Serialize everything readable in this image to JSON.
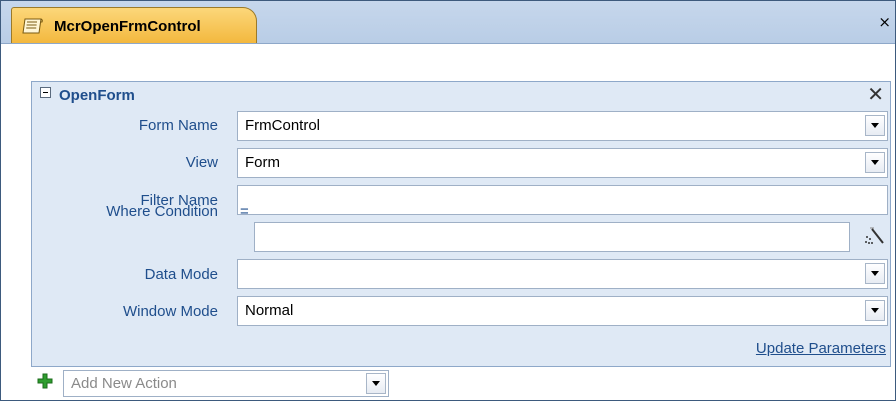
{
  "tab": {
    "title": "McrOpenFrmControl",
    "close": "×"
  },
  "action": {
    "name": "OpenForm",
    "remove": "✕",
    "rows": [
      {
        "label": "Form Name",
        "value": "FrmControl",
        "type": "dropdown"
      },
      {
        "label": "View",
        "value": "Form",
        "type": "dropdown"
      },
      {
        "label": "Filter Name",
        "value": "",
        "type": "text"
      },
      {
        "label": "Where Condition",
        "prefix": "=",
        "value": "",
        "type": "expression"
      },
      {
        "label": "Data Mode",
        "value": "",
        "type": "dropdown"
      },
      {
        "label": "Window Mode",
        "value": "Normal",
        "type": "dropdown"
      }
    ],
    "update_parameters": "Update Parameters"
  },
  "add_action": {
    "placeholder": "Add New Action"
  },
  "colors": {
    "accent_tab": "#f3b83e",
    "label_blue": "#1f4e8c",
    "panel_bg": "#dfe9f5",
    "plus_green": "#2e9d2e"
  },
  "icons": {
    "tab": "macro-scroll-icon",
    "collapse": "collapse-minus-icon",
    "remove": "close-icon",
    "builder": "expression-builder-wand-icon",
    "add": "green-plus-icon"
  }
}
